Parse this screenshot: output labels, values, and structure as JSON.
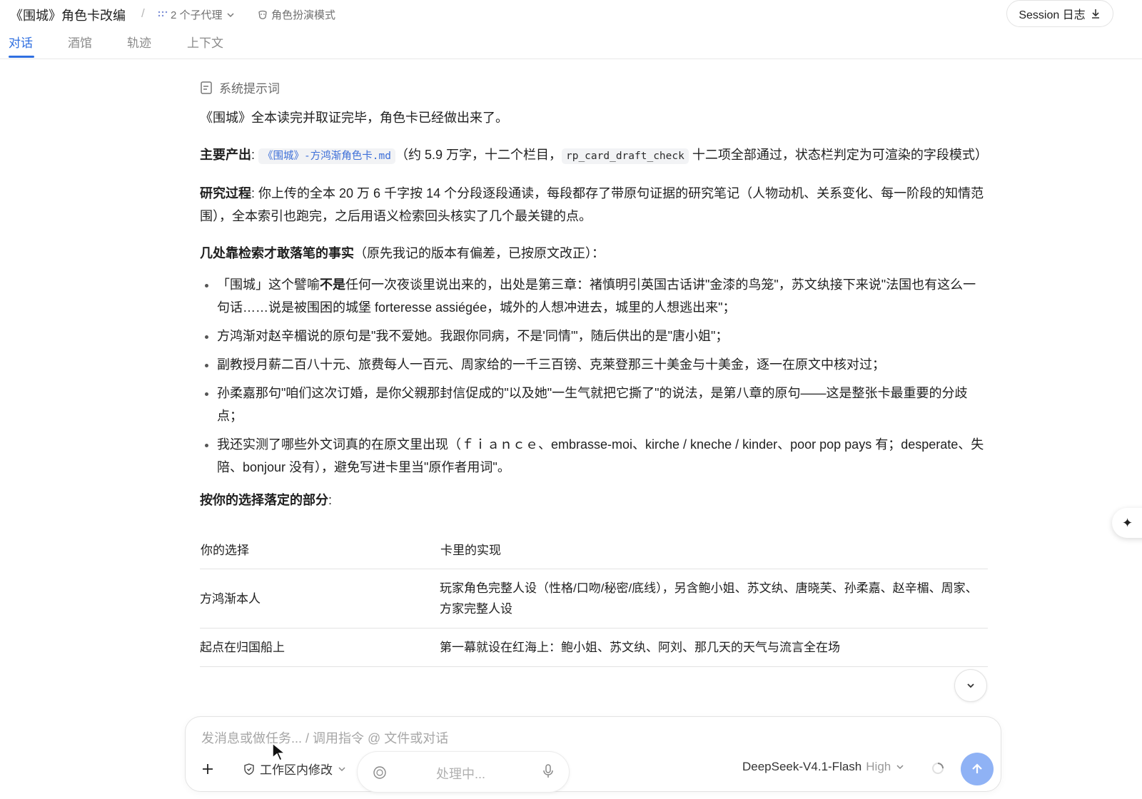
{
  "header": {
    "title": "《围城》角色卡改编",
    "separator": "/",
    "subagents": "2 个子代理",
    "mode": "角色扮演模式",
    "session_button": "Session 日志"
  },
  "tabs": [
    {
      "label": "对话",
      "active": true
    },
    {
      "label": "酒馆",
      "active": false
    },
    {
      "label": "轨迹",
      "active": false
    },
    {
      "label": "上下文",
      "active": false
    }
  ],
  "message": {
    "system_prompt_label": "系统提示词",
    "intro": "《围城》全本读完并取证完毕，角色卡已经做出来了。",
    "output_label": "主要产出",
    "colon": ":",
    "output_file": "《围城》-方鸿渐角色卡.md",
    "output_mid": "（约 5.9 万字，十二个栏目，",
    "output_check": "rp_card_draft_check",
    "output_tail": "十二项全部通过，状态栏判定为可渲染的字段模式）",
    "process_label": "研究过程",
    "process_text": "你上传的全本 20 万 6 千字按 14 个分段逐段通读，每段都存了带原句证据的研究笔记（人物动机、关系变化、每一阶段的知情范围），全本索引也跑完，之后用语义检索回头核实了几个最关键的点。",
    "facts_label": "几处靠检索才敢落笔的事实",
    "facts_note": "（原先我记的版本有偏差，已按原文改正）：",
    "bullets": {
      "b1_pre": "「围城」这个譬喻",
      "b1_bold": "不是",
      "b1_post": "任何一次夜谈里说出来的，出处是第三章：褚慎明引英国古话讲\"金漆的鸟笼\"，苏文纨接下来说\"法国也有这么一句话……说是被围困的城堡 forteresse assiégée，城外的人想冲进去，城里的人想逃出来\"；",
      "b2": "方鸿渐对赵辛楣说的原句是\"我不爱她。我跟你同病，不是'同情'\"，随后供出的是\"唐小姐\"；",
      "b3": "副教授月薪二百八十元、旅费每人一百元、周家给的一千三百镑、克莱登那三十美金与十美金，逐一在原文中核对过；",
      "b4": "孙柔嘉那句\"咱们这次订婚，是你父親那封信促成的\"以及她\"一生气就把它撕了\"的说法，是第八章的原句——这是整张卡最重要的分歧点；",
      "b5": "我还实测了哪些外文词真的在原文里出现（ｆｉａｎｃｅ、embrasse-moi、kirche / kneche / kinder、poor pop pays 有；desperate、失陪、bonjour 没有），避免写进卡里当\"原作者用词\"。"
    },
    "choices_label": "按你的选择落定的部分",
    "table": {
      "headers": [
        "你的选择",
        "卡里的实现"
      ],
      "rows": [
        {
          "choice": "方鸿渐本人",
          "impl": "玩家角色完整人设（性格/口吻/秘密/底线），另含鲍小姐、苏文纨、唐晓芙、孙柔嘉、赵辛楣、周家、方家完整人设"
        },
        {
          "choice": "起点在归国船上",
          "impl": "第一幕就设在红海上：鲍小姐、苏文纨、阿刘、那几天的天气与流言全在场"
        }
      ]
    }
  },
  "composer": {
    "placeholder": "发消息或做任务... / 调用指令 @ 文件或对话",
    "permission": "工作区内修改",
    "processing": "处理中...",
    "model_name": "DeepSeek-V4.1-Flash",
    "model_level": "High"
  },
  "float_side": "✦ ",
  "colors": {
    "accent": "#2f6fe0",
    "send_button": "#8fb2f5",
    "link": "#3d6fd8"
  }
}
